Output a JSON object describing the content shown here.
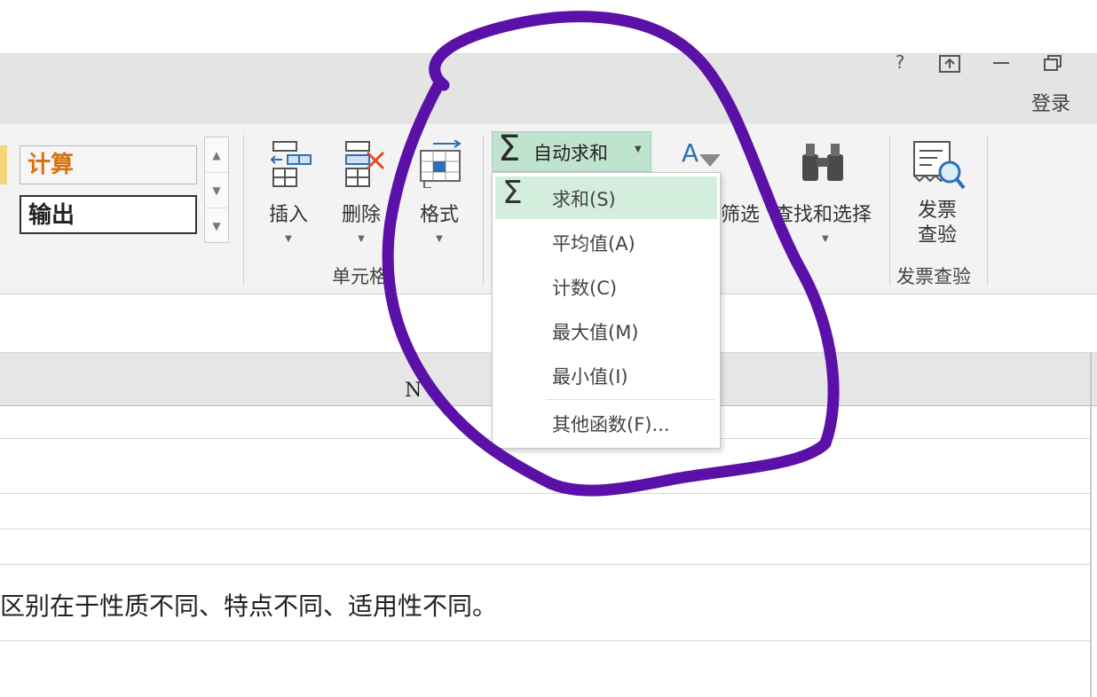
{
  "titlebar": {
    "help_glyph": "?",
    "login_label": "登录"
  },
  "styles": {
    "calc_label": "计算",
    "output_label": "输出"
  },
  "cells_group": {
    "insert_label": "插入",
    "delete_label": "删除",
    "format_label": "格式",
    "group_label": "单元格"
  },
  "editing": {
    "autosum_label": "自动求和",
    "filter_label": "筛选",
    "find_select_label": "查找和选择"
  },
  "invoice": {
    "button_label": "发票查验",
    "button_label_line1": "发票",
    "button_label_line2": "查验",
    "group_label": "发票查验"
  },
  "dropdown": {
    "items": [
      {
        "label": "求和(S)"
      },
      {
        "label": "平均值(A)"
      },
      {
        "label": "计数(C)"
      },
      {
        "label": "最大值(M)"
      },
      {
        "label": "最小值(I)"
      },
      {
        "label": "其他函数(F)..."
      }
    ]
  },
  "sheet": {
    "column_letter": "N",
    "cell_text": "区别在于性质不同、特点不同、适用性不同。"
  },
  "colors": {
    "annotation": "#5b11a8",
    "autosum_bg": "#bfe3cd",
    "calc_text": "#d7730e"
  }
}
